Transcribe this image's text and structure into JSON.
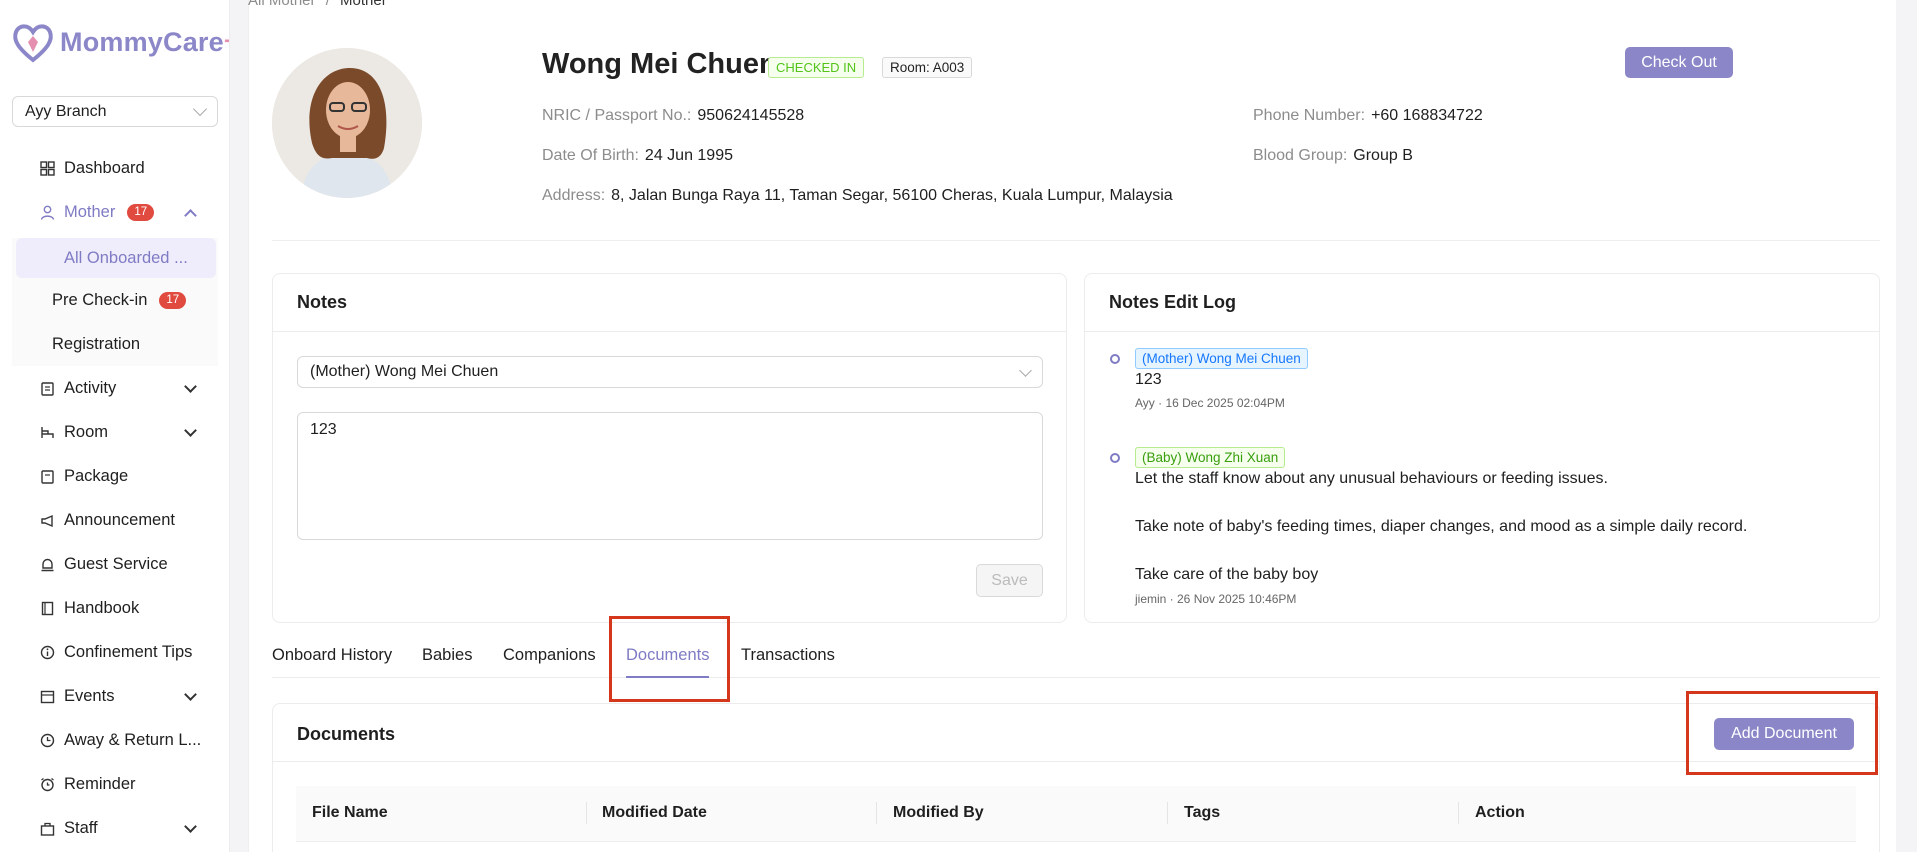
{
  "app": {
    "brand": "MommyCare",
    "brand_plus": "+"
  },
  "branch": {
    "selected": "Ayy Branch"
  },
  "sidebar": {
    "items": [
      {
        "label": "Dashboard"
      },
      {
        "label": "Mother",
        "badge": "17"
      },
      {
        "label": "Activity"
      },
      {
        "label": "Room"
      },
      {
        "label": "Package"
      },
      {
        "label": "Announcement"
      },
      {
        "label": "Guest Service"
      },
      {
        "label": "Handbook"
      },
      {
        "label": "Confinement Tips"
      },
      {
        "label": "Events"
      },
      {
        "label": "Away & Return L..."
      },
      {
        "label": "Reminder"
      },
      {
        "label": "Staff"
      }
    ],
    "mother_sub": [
      {
        "label": "All Onboarded ..."
      },
      {
        "label": "Pre Check-in",
        "badge": "17"
      },
      {
        "label": "Registration"
      }
    ]
  },
  "breadcrumb": {
    "parent": "All Mother",
    "sep": "/",
    "current": "Mother"
  },
  "profile": {
    "name": "Wong Mei Chuen",
    "status": "CHECKED IN",
    "room": "Room: A003",
    "checkout_label": "Check Out",
    "nric_label": "NRIC / Passport No.:",
    "nric": "950624145528",
    "dob_label": "Date Of Birth:",
    "dob": "24 Jun 1995",
    "address_label": "Address:",
    "address": "8, Jalan Bunga Raya 11, Taman Segar, 56100 Cheras, Kuala Lumpur, Malaysia",
    "phone_label": "Phone Number:",
    "phone": "+60 168834722",
    "blood_label": "Blood Group:",
    "blood": "Group B"
  },
  "notes": {
    "title": "Notes",
    "selected_person": "(Mother) Wong Mei Chuen",
    "text": "123",
    "save_label": "Save"
  },
  "edit_log": {
    "title": "Notes Edit Log",
    "entries": [
      {
        "tag": "(Mother) Wong Mei Chuen",
        "lines": [
          "123"
        ],
        "meta": "Ayy · 16 Dec 2025 02:04PM"
      },
      {
        "tag": "(Baby) Wong Zhi Xuan",
        "lines": [
          "Let the staff know about any unusual behaviours or feeding issues.",
          "Take note of baby's feeding times, diaper changes, and mood as a simple daily record.",
          "Take care of the baby boy"
        ],
        "meta": "jiemin · 26 Nov 2025 10:46PM"
      }
    ]
  },
  "tabs": [
    "Onboard History",
    "Babies",
    "Companions",
    "Documents",
    "Transactions"
  ],
  "documents": {
    "title": "Documents",
    "add_label": "Add Document",
    "columns": [
      "File Name",
      "Modified Date",
      "Modified By",
      "Tags",
      "Action"
    ]
  },
  "colors": {
    "accent": "#8a86c8",
    "badge": "#e04a3f",
    "highlight": "#d5371c"
  }
}
